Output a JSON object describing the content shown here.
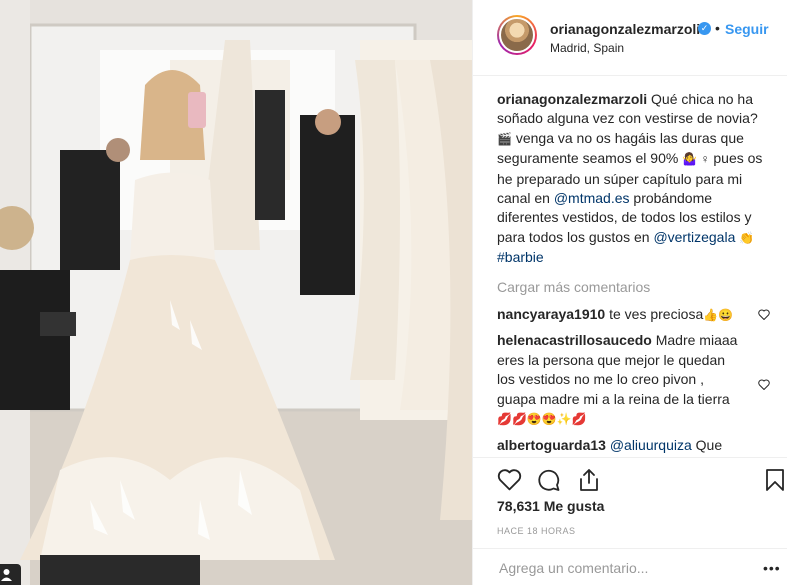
{
  "post_image": {
    "alt": ""
  },
  "header": {
    "username": "orianagonzalezmarzoli",
    "follow_label": "Seguir",
    "dot": "•",
    "location": "Madrid, Spain"
  },
  "caption": {
    "username": "orianagonzalezmarzoli",
    "text_1": " Qué chica no ha soñado alguna vez con vestirse de novia? ",
    "emoji_1": "🎬",
    "text_2": " venga va no os hagáis las duras que seguramente seamos el 90% ",
    "emoji_2": "🤷‍♀️ ♀",
    "text_3": " pues os he preparado un súper capítulo para mi canal en ",
    "mention_1": "@mtmad.es",
    "text_4": " probándome diferentes vestidos, de todos los estilos y para todos los gustos en ",
    "mention_2": "@vertizegala",
    "emoji_3": "👏",
    "hashtag": "#barbie"
  },
  "load_more_label": "Cargar más comentarios",
  "comments": [
    {
      "username": "nancyaraya1910",
      "text": " te ves preciosa",
      "emoji": "👍😀"
    },
    {
      "username": "helenacastrillosaucedo",
      "text": " Madre miaaa eres la persona que mejor le quedan los vestidos no me lo creo pivon , guapa madre mi a la reina de la tierra ",
      "emoji": "💋💋😍😍✨💋"
    },
    {
      "username": "albertoguarda13",
      "mention": "@aliuurquiza",
      "text": " Que Verdad mas grande que un templo amiga la Ori esta aun nivel"
    }
  ],
  "likes_label": "78,631 Me gusta",
  "time_ago": "HACE 18 HORAS",
  "add_comment": {
    "placeholder": "Agrega un comentario...",
    "more": "•••"
  },
  "icons": [
    "heart-icon",
    "comment-icon",
    "share-icon",
    "bookmark-icon",
    "verified-icon",
    "user-icon"
  ],
  "colors": {
    "link": "#003569",
    "follow": "#3897f0",
    "muted": "#999999",
    "text": "#262626"
  }
}
